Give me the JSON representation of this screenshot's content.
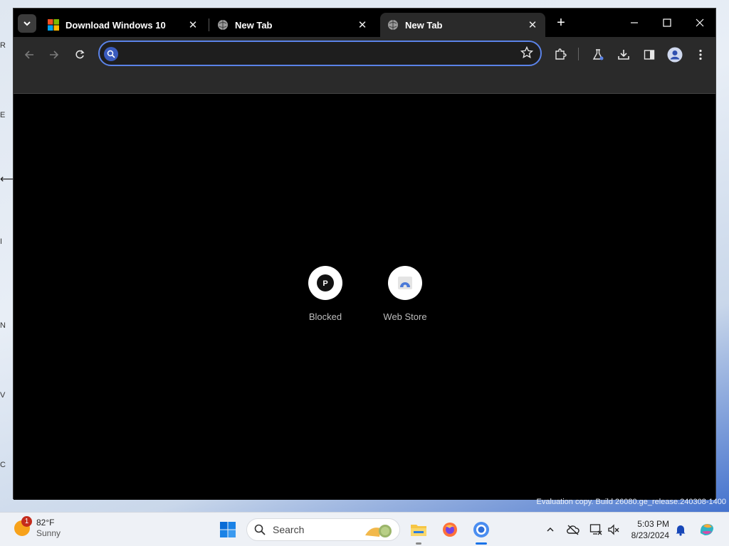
{
  "desktop": {
    "fragments": [
      "R",
      "E",
      "I",
      "N",
      "V",
      "C"
    ]
  },
  "browser": {
    "tabs": [
      {
        "title": "Download Windows 10",
        "favicon": "windows-logo-icon",
        "active": false
      },
      {
        "title": "New Tab",
        "favicon": "globe-icon",
        "active": false
      },
      {
        "title": "New Tab",
        "favicon": "globe-icon",
        "active": true
      }
    ],
    "close_glyph": "✕",
    "new_tab_glyph": "+",
    "omnibox": {
      "value": "",
      "placeholder": ""
    },
    "shortcuts": [
      {
        "label": "Blocked",
        "letter": "P",
        "icon": "p-letter-icon"
      },
      {
        "label": "Web Store",
        "icon": "web-store-icon"
      }
    ],
    "colors": {
      "accent": "#5b83e8",
      "tab_active": "#2a2a2a",
      "toolbar": "#2a2a2a"
    }
  },
  "watermark": "Evaluation copy. Build 26080.ge_release.240308-1400",
  "taskbar": {
    "weather": {
      "temp": "82°F",
      "condition": "Sunny",
      "badge": "1"
    },
    "search_label": "Search",
    "clock": {
      "time": "5:03 PM",
      "date": "8/23/2024"
    }
  }
}
